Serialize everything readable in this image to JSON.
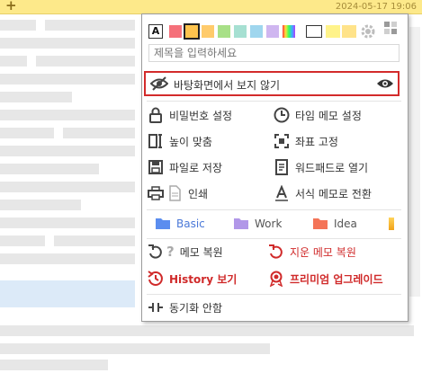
{
  "topbar": {
    "add_label": "+",
    "datetime": "2024-05-17  19:06"
  },
  "menu": {
    "colors": {
      "font_toggle_label": "A",
      "swatches": [
        "#f5707a",
        "#fec44e",
        "#ffcb6b",
        "#a8e087",
        "#a6e0d2",
        "#9fd6ee",
        "#cfb6f0",
        "#ffffff",
        "#fff38a",
        "#ffe38a"
      ],
      "accent": "#d32b2b"
    },
    "title_input": {
      "placeholder": "제목을 입력하세요"
    },
    "hide_desktop": {
      "label": "바탕화면에서 보지 않기"
    },
    "items": {
      "password": "비밀번호 설정",
      "timer": "타임 메모 설정",
      "height": "높이 맞춤",
      "fix_position": "좌표 고정",
      "save_file": "파일로 저장",
      "wordpad": "워드패드로 열기",
      "print": "인쇄",
      "format": "서식 메모로 전환",
      "restore": "메모 복원",
      "restore_deleted": "지운 메모 복원",
      "history": "History 보기",
      "premium": "프리미엄 업그레이드",
      "sync": "동기화 안함"
    },
    "folders": [
      {
        "label": "Basic",
        "color": "#5b8def",
        "text_color": "#4a78d8"
      },
      {
        "label": "Work",
        "color": "#b197e8",
        "text_color": "#555555"
      },
      {
        "label": "Idea",
        "color": "#f47458",
        "text_color": "#555555"
      }
    ]
  }
}
